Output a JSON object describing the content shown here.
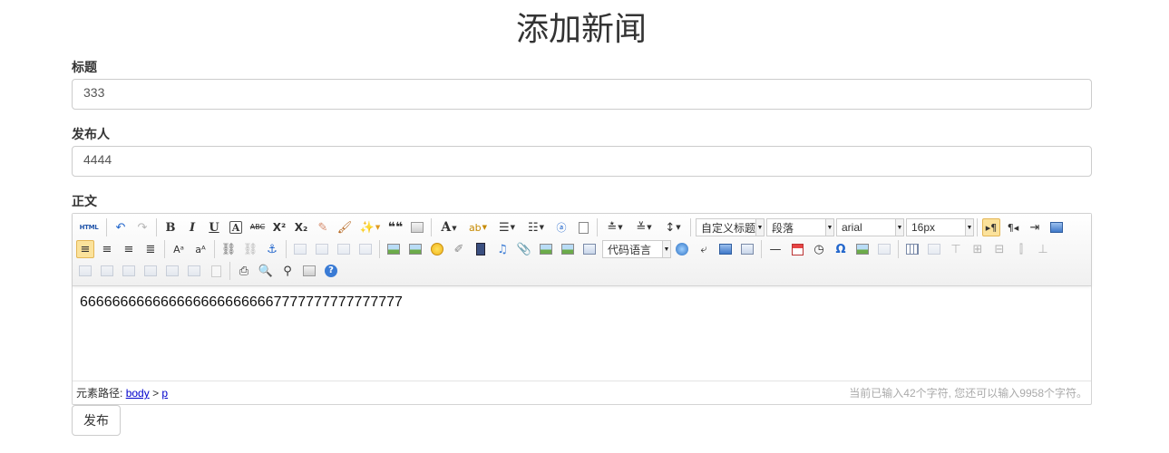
{
  "page": {
    "title": "添加新闻"
  },
  "form": {
    "title_label": "标题",
    "title_value": "333",
    "author_label": "发布人",
    "author_value": "4444",
    "body_label": "正文",
    "submit_label": "发布"
  },
  "editor": {
    "toolbar": {
      "html_label": "HTML",
      "bold": "B",
      "italic": "I",
      "underline": "U",
      "fontborder": "A",
      "strikethrough": "ABC",
      "superscript": "X²",
      "subscript": "X₂",
      "blockquote": "❝❝",
      "forecolor": "A",
      "customstyle_value": "自定义标题",
      "paragraph_value": "段落",
      "fontfamily_value": "arial",
      "fontsize_value": "16px",
      "codelang_value": "代码语言",
      "special_chars": "Ω",
      "help": "?"
    },
    "content": "6666666666666666666666667777777777777777",
    "status": {
      "path_label": "元素路径:",
      "path_body": "body",
      "path_sep": ">",
      "path_p": "p",
      "char_count": "当前已输入42个字符, 您还可以输入9958个字符。"
    }
  }
}
